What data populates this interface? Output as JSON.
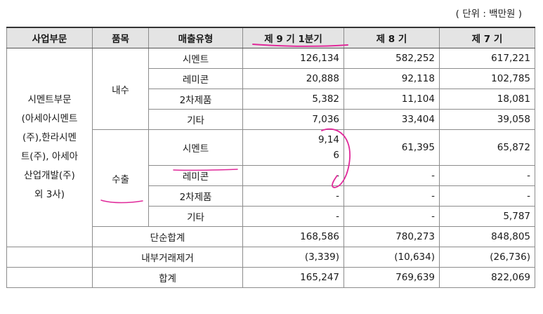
{
  "unit_note": "( 단위 : 백만원 )",
  "headers": [
    "사업부문",
    "품목",
    "매출유형",
    "제 9 기 1분기",
    "제 8 기",
    "제 7 기"
  ],
  "segment_lines": [
    "시멘트부문",
    "(아세아시멘트",
    "(주),한라시멘",
    "트(주), 아세아",
    "산업개발(주)",
    "외 3사)"
  ],
  "groups": {
    "domestic": "내수",
    "export": "수출"
  },
  "rows": [
    {
      "type": "시멘트",
      "q1": "126,134",
      "p8": "582,252",
      "p7": "617,221"
    },
    {
      "type": "레미콘",
      "q1": "20,888",
      "p8": "92,118",
      "p7": "102,785"
    },
    {
      "type": "2차제품",
      "q1": "5,382",
      "p8": "11,104",
      "p7": "18,081"
    },
    {
      "type": "기타",
      "q1": "7,036",
      "p8": "33,404",
      "p7": "39,058"
    },
    {
      "type": "시멘트",
      "q1_line1": "9,14",
      "q1_line2": "6",
      "p8": "61,395",
      "p7": "65,872"
    },
    {
      "type": "레미콘",
      "q1": "-",
      "p8": "-",
      "p7": "-"
    },
    {
      "type": "2차제품",
      "q1": "-",
      "p8": "-",
      "p7": "-"
    },
    {
      "type": "기타",
      "q1": "-",
      "p8": "-",
      "p7": "5,787"
    }
  ],
  "totals": [
    {
      "label": "단순합계",
      "q1": "168,586",
      "p8": "780,273",
      "p7": "848,805"
    },
    {
      "label": "내부거래제거",
      "q1": "(3,339)",
      "p8": "(10,634)",
      "p7": "(26,736)"
    },
    {
      "label": "합계",
      "q1": "165,247",
      "p8": "769,639",
      "p7": "822,069"
    }
  ],
  "annotation_color": "#e0299a"
}
